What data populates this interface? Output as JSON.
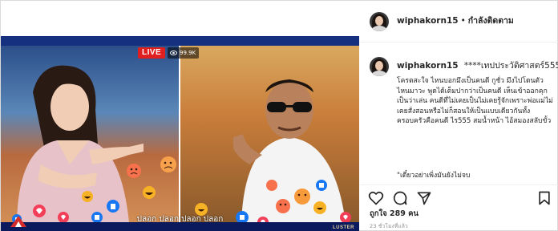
{
  "video": {
    "live_label": "LIVE",
    "viewer_count": "99.9K",
    "caption": "ปลอก ปลอก ปลอก ปลอก",
    "watermark": "LUSTER"
  },
  "post_header": {
    "username": "wiphakorn15",
    "separator": "•",
    "follow_status": "กำลังติดตาม",
    "more_icon": "more-horizontal-icon"
  },
  "comment": {
    "username": "wiphakorn15",
    "headline": "****เทปประวัติศาสตร์5555",
    "body": "โครตสะใจ ไหนบอกมึงเป็นคนดี กูชั่ว มึงไปโดนตัวไหนมาวะ พูดได้เต็มปากว่าเป็นคนดี เห็นเข้าออกคุกเป็นว่าเล่น คนดีที่ไม่เคยเป็นไม่เคยรู้จักเพราะพ่อแม่ไม่เคยสั่งสอนหรือไม่ก็สอนให้เป็นแบบเดียวกันทั้งครอบครัวคือคนดี ไร555 สมน้ำหน้า ไอ้สมองสลับขั้ว",
    "extra": "\"เดี๋ยวอย่าเพิ่งมันยังไม่จบ"
  },
  "actions": {
    "like_icon": "heart-icon",
    "comment_icon": "comment-icon",
    "share_icon": "share-icon",
    "save_icon": "bookmark-icon"
  },
  "likes_text": "ถูกใจ 289 คน",
  "time_text": "23 ชั่วโมงที่แล้ว",
  "colors": {
    "live_red": "#e02020",
    "like_blue": "#1877f2",
    "love_red": "#f33e58",
    "angry_orange": "#f7714c",
    "haha_yellow": "#f7b125"
  }
}
